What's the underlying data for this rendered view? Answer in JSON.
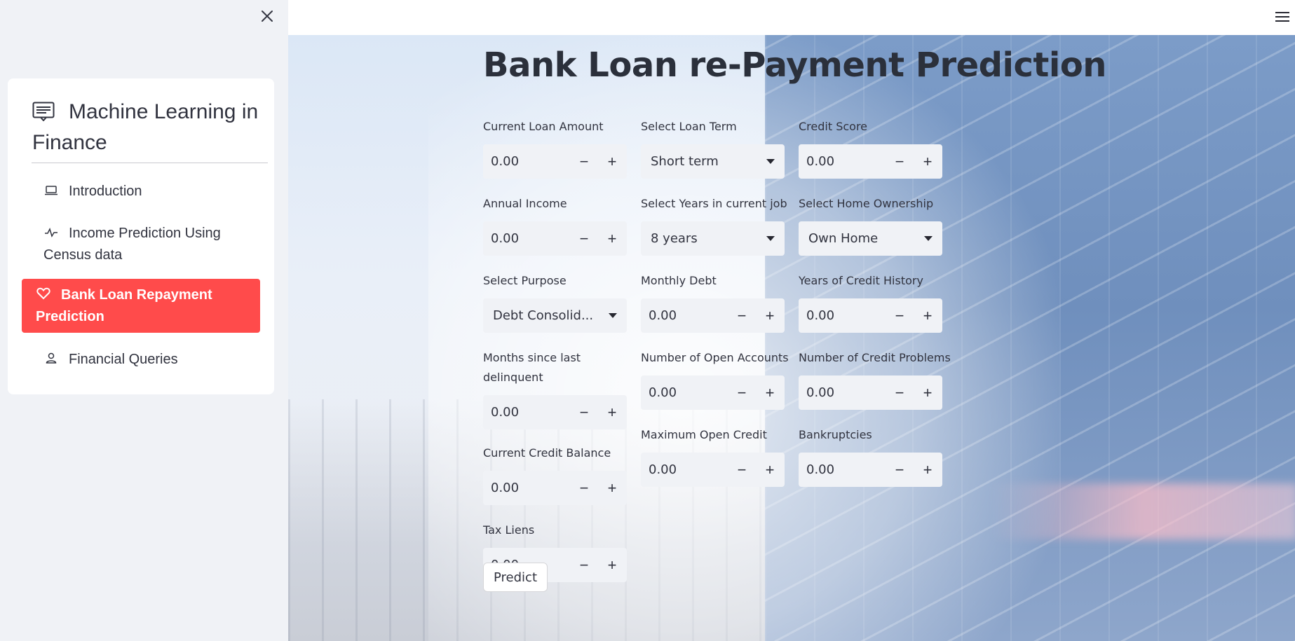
{
  "sidebar": {
    "close_icon": "close-icon",
    "menu_title": "Machine Learning in Finance",
    "items": [
      {
        "label": "Introduction",
        "icon": "laptop-icon",
        "active": false
      },
      {
        "label": "Income Prediction Using Census data",
        "icon": "activity-icon",
        "active": false
      },
      {
        "label": "Bank Loan Repayment Prediction",
        "icon": "heart-icon",
        "active": true
      },
      {
        "label": "Financial Queries",
        "icon": "person-icon",
        "active": false
      }
    ],
    "accent_color": "#ff4b4b"
  },
  "header": {
    "menu_icon": "hamburger-icon"
  },
  "main": {
    "title": "Bank Loan re-Payment Prediction",
    "fields": {
      "current_loan_amount": {
        "label": "Current Loan Amount",
        "value": "0.00"
      },
      "loan_term": {
        "label": "Select Loan Term",
        "value": "Short term"
      },
      "credit_score": {
        "label": "Credit Score",
        "value": "0.00"
      },
      "annual_income": {
        "label": "Annual Income",
        "value": "0.00"
      },
      "years_in_job": {
        "label": "Select Years in current job",
        "value": "8 years"
      },
      "home_ownership": {
        "label": "Select Home Ownership",
        "value": "Own Home"
      },
      "purpose": {
        "label": "Select Purpose",
        "value": "Debt Consolid..."
      },
      "monthly_debt": {
        "label": "Monthly Debt",
        "value": "0.00"
      },
      "years_credit_history": {
        "label": "Years of Credit History",
        "value": "0.00"
      },
      "months_since_delinquent": {
        "label": "Months since last delinquent",
        "value": "0.00"
      },
      "open_accounts": {
        "label": "Number of Open Accounts",
        "value": "0.00"
      },
      "credit_problems": {
        "label": "Number of Credit Problems",
        "value": "0.00"
      },
      "current_credit_balance": {
        "label": "Current Credit Balance",
        "value": "0.00"
      },
      "max_open_credit": {
        "label": "Maximum Open Credit",
        "value": "0.00"
      },
      "bankruptcies": {
        "label": "Bankruptcies",
        "value": "0.00"
      },
      "tax_liens": {
        "label": "Tax Liens",
        "value": "0.00"
      }
    },
    "stepper": {
      "minus": "−",
      "plus": "+"
    },
    "predict_label": "Predict"
  }
}
